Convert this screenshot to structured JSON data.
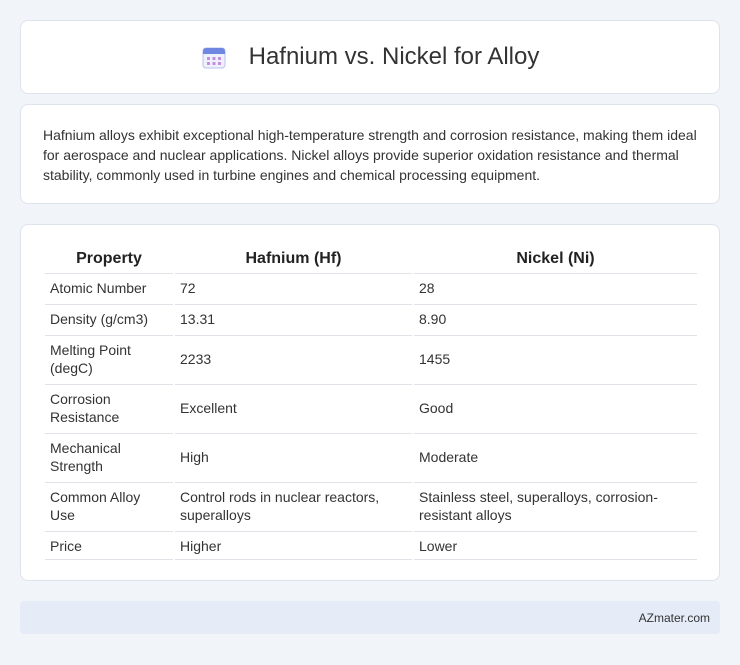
{
  "header": {
    "title": "Hafnium vs. Nickel for Alloy",
    "icon": "calendar-icon"
  },
  "intro": {
    "text": "Hafnium alloys exhibit exceptional high-temperature strength and corrosion resistance, making them ideal for aerospace and nuclear applications. Nickel alloys provide superior oxidation resistance and thermal stability, commonly used in turbine engines and chemical processing equipment."
  },
  "table": {
    "columns": [
      "Property",
      "Hafnium (Hf)",
      "Nickel (Ni)"
    ],
    "rows": [
      [
        "Atomic Number",
        "72",
        "28"
      ],
      [
        "Density (g/cm3)",
        "13.31",
        "8.90"
      ],
      [
        "Melting Point (degC)",
        "2233",
        "1455"
      ],
      [
        "Corrosion Resistance",
        "Excellent",
        "Good"
      ],
      [
        "Mechanical Strength",
        "High",
        "Moderate"
      ],
      [
        "Common Alloy Use",
        "Control rods in nuclear reactors, superalloys",
        "Stainless steel, superalloys, corrosion-resistant alloys"
      ],
      [
        "Price",
        "Higher",
        "Lower"
      ]
    ]
  },
  "footer": {
    "brand": "AZmater.com"
  }
}
